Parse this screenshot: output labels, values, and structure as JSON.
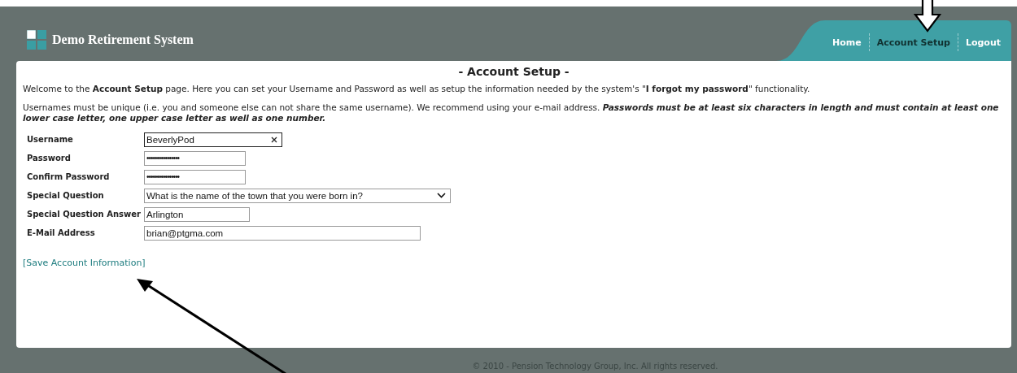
{
  "header": {
    "title": "Demo Retirement System",
    "nav": [
      {
        "label": "Home",
        "selected": false
      },
      {
        "label": "Account Setup",
        "selected": true
      },
      {
        "label": "Logout",
        "selected": false
      }
    ]
  },
  "page_title": "- Account Setup -",
  "paragraphs": [
    "Welcome to the **Account Setup** page. Here you can set your Username and Password as well as setup the information needed by the system's \"**I forgot my password**\" functionality.",
    "Usernames must be unique (i.e. you and someone else can not share the same username). We recommend using your e-mail address. *Passwords must be at least six characters in length and must contain at least one lower case letter, one upper case letter as well as one number.*"
  ],
  "form": {
    "fields": [
      {
        "label": "Username",
        "kind": "text",
        "value": "BeverlyPod",
        "clearable": true
      },
      {
        "label": "Password",
        "kind": "password",
        "value": "••••••••••••••••",
        "clearable": false
      },
      {
        "label": "Confirm Password",
        "kind": "password",
        "value": "••••••••••••••••",
        "clearable": false
      },
      {
        "label": "Special Question",
        "kind": "select",
        "value": "What is the name of the town that you were born in?",
        "clearable": false
      },
      {
        "label": "Special Question Answer",
        "kind": "text",
        "value": "Arlington",
        "clearable": false
      },
      {
        "label": "E-Mail Address",
        "kind": "email",
        "value": "brian@ptgma.com",
        "clearable": false
      }
    ]
  },
  "save_link": "[Save Account Information]",
  "footer": "© 2010 - Pension Technology Group, Inc. All rights reserved."
}
